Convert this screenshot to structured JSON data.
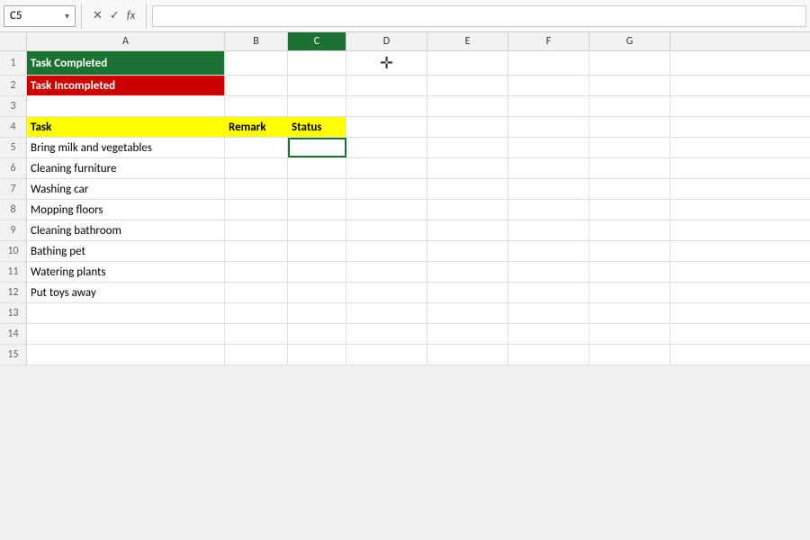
{
  "formulaBar": {
    "cellRef": "C5",
    "chevron": "▾",
    "iconX": "✕",
    "iconCheck": "✓",
    "iconFx": "fx",
    "formulaValue": ""
  },
  "columns": {
    "rowHeader": "",
    "headers": [
      "A",
      "B",
      "C",
      "D",
      "E",
      "F",
      "G"
    ]
  },
  "rows": [
    {
      "num": "1",
      "cells": [
        {
          "text": "Task Completed",
          "style": "bg-green col-a"
        },
        {
          "text": "",
          "style": "col-b"
        },
        {
          "text": "",
          "style": "col-c"
        },
        {
          "text": "",
          "style": "col-d cursor-cross"
        },
        {
          "text": "",
          "style": "col-e"
        },
        {
          "text": "",
          "style": "col-f"
        },
        {
          "text": "",
          "style": "col-g"
        }
      ]
    },
    {
      "num": "2",
      "cells": [
        {
          "text": "Task Incompleted",
          "style": "bg-red col-a"
        },
        {
          "text": "",
          "style": "col-b"
        },
        {
          "text": "",
          "style": "col-c"
        },
        {
          "text": "",
          "style": "col-d"
        },
        {
          "text": "",
          "style": "col-e"
        },
        {
          "text": "",
          "style": "col-f"
        },
        {
          "text": "",
          "style": "col-g"
        }
      ]
    },
    {
      "num": "3",
      "cells": [
        {
          "text": "",
          "style": "col-a"
        },
        {
          "text": "",
          "style": "col-b"
        },
        {
          "text": "",
          "style": "col-c"
        },
        {
          "text": "",
          "style": "col-d"
        },
        {
          "text": "",
          "style": "col-e"
        },
        {
          "text": "",
          "style": "col-f"
        },
        {
          "text": "",
          "style": "col-g"
        }
      ]
    },
    {
      "num": "4",
      "cells": [
        {
          "text": "Task",
          "style": "bg-yellow col-a"
        },
        {
          "text": "Remark",
          "style": "bg-yellow col-b"
        },
        {
          "text": "Status",
          "style": "bg-yellow col-c"
        },
        {
          "text": "",
          "style": "col-d"
        },
        {
          "text": "",
          "style": "col-e"
        },
        {
          "text": "",
          "style": "col-f"
        },
        {
          "text": "",
          "style": "col-g"
        }
      ]
    },
    {
      "num": "5",
      "cells": [
        {
          "text": "Bring milk and vegetables",
          "style": "col-a"
        },
        {
          "text": "",
          "style": "col-b"
        },
        {
          "text": "",
          "style": "col-c cell-selected"
        },
        {
          "text": "",
          "style": "col-d"
        },
        {
          "text": "",
          "style": "col-e"
        },
        {
          "text": "",
          "style": "col-f"
        },
        {
          "text": "",
          "style": "col-g"
        }
      ]
    },
    {
      "num": "6",
      "cells": [
        {
          "text": "Cleaning furniture",
          "style": "col-a"
        },
        {
          "text": "",
          "style": "col-b"
        },
        {
          "text": "",
          "style": "col-c"
        },
        {
          "text": "",
          "style": "col-d"
        },
        {
          "text": "",
          "style": "col-e"
        },
        {
          "text": "",
          "style": "col-f"
        },
        {
          "text": "",
          "style": "col-g"
        }
      ]
    },
    {
      "num": "7",
      "cells": [
        {
          "text": "Washing car",
          "style": "col-a"
        },
        {
          "text": "",
          "style": "col-b"
        },
        {
          "text": "",
          "style": "col-c"
        },
        {
          "text": "",
          "style": "col-d"
        },
        {
          "text": "",
          "style": "col-e"
        },
        {
          "text": "",
          "style": "col-f"
        },
        {
          "text": "",
          "style": "col-g"
        }
      ]
    },
    {
      "num": "8",
      "cells": [
        {
          "text": "Mopping floors",
          "style": "col-a"
        },
        {
          "text": "",
          "style": "col-b"
        },
        {
          "text": "",
          "style": "col-c"
        },
        {
          "text": "",
          "style": "col-d"
        },
        {
          "text": "",
          "style": "col-e"
        },
        {
          "text": "",
          "style": "col-f"
        },
        {
          "text": "",
          "style": "col-g"
        }
      ]
    },
    {
      "num": "9",
      "cells": [
        {
          "text": "Cleaning bathroom",
          "style": "col-a"
        },
        {
          "text": "",
          "style": "col-b"
        },
        {
          "text": "",
          "style": "col-c"
        },
        {
          "text": "",
          "style": "col-d"
        },
        {
          "text": "",
          "style": "col-e"
        },
        {
          "text": "",
          "style": "col-f"
        },
        {
          "text": "",
          "style": "col-g"
        }
      ]
    },
    {
      "num": "10",
      "cells": [
        {
          "text": "Bathing pet",
          "style": "col-a"
        },
        {
          "text": "",
          "style": "col-b"
        },
        {
          "text": "",
          "style": "col-c"
        },
        {
          "text": "",
          "style": "col-d"
        },
        {
          "text": "",
          "style": "col-e"
        },
        {
          "text": "",
          "style": "col-f"
        },
        {
          "text": "",
          "style": "col-g"
        }
      ]
    },
    {
      "num": "11",
      "cells": [
        {
          "text": "Watering plants",
          "style": "col-a"
        },
        {
          "text": "",
          "style": "col-b"
        },
        {
          "text": "",
          "style": "col-c"
        },
        {
          "text": "",
          "style": "col-d"
        },
        {
          "text": "",
          "style": "col-e"
        },
        {
          "text": "",
          "style": "col-f"
        },
        {
          "text": "",
          "style": "col-g"
        }
      ]
    },
    {
      "num": "12",
      "cells": [
        {
          "text": "Put toys away",
          "style": "col-a"
        },
        {
          "text": "",
          "style": "col-b"
        },
        {
          "text": "",
          "style": "col-c"
        },
        {
          "text": "",
          "style": "col-d"
        },
        {
          "text": "",
          "style": "col-e"
        },
        {
          "text": "",
          "style": "col-f"
        },
        {
          "text": "",
          "style": "col-g"
        }
      ]
    },
    {
      "num": "13",
      "cells": [
        {
          "text": "",
          "style": "col-a"
        },
        {
          "text": "",
          "style": "col-b"
        },
        {
          "text": "",
          "style": "col-c"
        },
        {
          "text": "",
          "style": "col-d"
        },
        {
          "text": "",
          "style": "col-e"
        },
        {
          "text": "",
          "style": "col-f"
        },
        {
          "text": "",
          "style": "col-g"
        }
      ]
    },
    {
      "num": "14",
      "cells": [
        {
          "text": "",
          "style": "col-a"
        },
        {
          "text": "",
          "style": "col-b"
        },
        {
          "text": "",
          "style": "col-c"
        },
        {
          "text": "",
          "style": "col-d"
        },
        {
          "text": "",
          "style": "col-e"
        },
        {
          "text": "",
          "style": "col-f"
        },
        {
          "text": "",
          "style": "col-g"
        }
      ]
    },
    {
      "num": "15",
      "cells": [
        {
          "text": "",
          "style": "col-a"
        },
        {
          "text": "",
          "style": "col-b"
        },
        {
          "text": "",
          "style": "col-c"
        },
        {
          "text": "",
          "style": "col-d"
        },
        {
          "text": "",
          "style": "col-e"
        },
        {
          "text": "",
          "style": "col-f"
        },
        {
          "text": "",
          "style": "col-g"
        }
      ]
    }
  ]
}
